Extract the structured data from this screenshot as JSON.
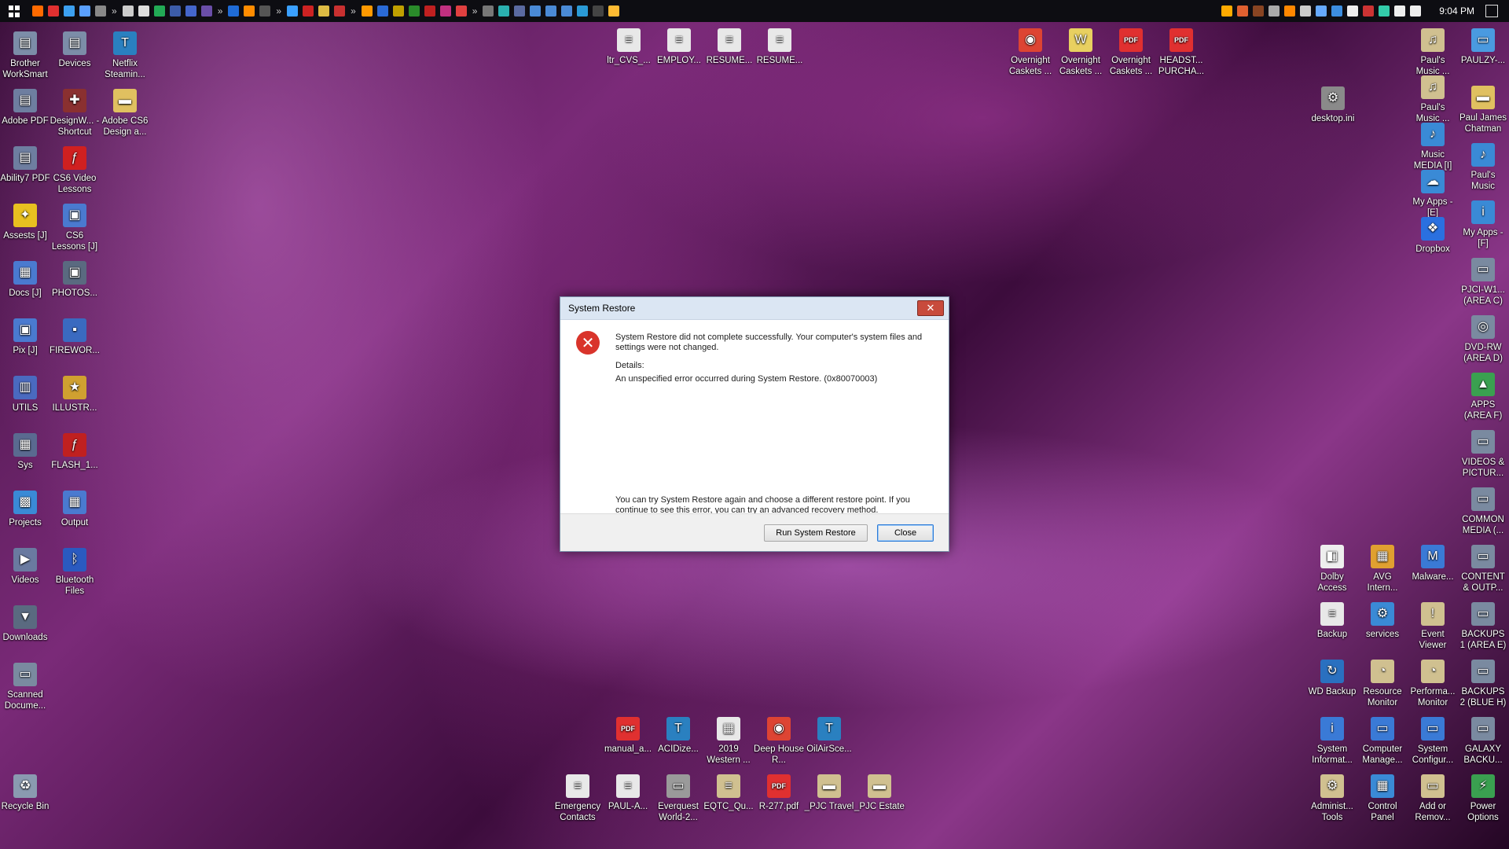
{
  "taskbar": {
    "clock": "9:04 PM",
    "more_glyph": "»",
    "icons_left": [
      "#ff6a00",
      "#e03030",
      "#3ca0f0",
      "#5aa0ff",
      "#888",
      "#ccc",
      "#ddd",
      "#22aa55",
      "#3c5ca8",
      "#4466cc",
      "#6a4ea8",
      "#1f6bd6",
      "#ff8c00",
      "#555",
      "#3aa0ff",
      "#cc2222",
      "#ddbb44",
      "#c83030",
      "#ff9900",
      "#2a6ad6",
      "#c0a000",
      "#2a8a2a",
      "#c02020",
      "#c03080",
      "#e04040",
      "#777",
      "#2ab0b0",
      "#5a6aa0",
      "#4a8ad6",
      "#4a8ad6",
      "#4a8ad6",
      "#2a9ad6",
      "#444",
      "#ffbb33"
    ],
    "icons_tray": [
      "#ffaa00",
      "#e06030",
      "#884422",
      "#aaa",
      "#ff8800",
      "#ccc",
      "#66aaff",
      "#3c8ee0",
      "#eee",
      "#cc3333",
      "#33ccaa",
      "#eee",
      "#eee"
    ]
  },
  "desktop": {
    "left_col1": [
      {
        "label": "Brother WorkSmart",
        "icon": "printer-icon",
        "color": "#7c8da8",
        "glyph": "▤"
      },
      {
        "label": "Adobe PDF",
        "icon": "printer-icon",
        "color": "#6e7ea0",
        "glyph": "▤"
      },
      {
        "label": "Ability7 PDF",
        "icon": "printer-icon",
        "color": "#6e7ea0",
        "glyph": "▤"
      },
      {
        "label": "Assests [J]",
        "icon": "lightbulb-icon",
        "color": "#e8c020",
        "glyph": "✦"
      },
      {
        "label": "Docs [J]",
        "icon": "documents-icon",
        "color": "#4a7ad0",
        "glyph": "▦"
      },
      {
        "label": "Pix [J]",
        "icon": "pictures-icon",
        "color": "#4a7ad0",
        "glyph": "▣"
      },
      {
        "label": "UTILS",
        "icon": "folder-icon",
        "color": "#4a6ac0",
        "glyph": "▥"
      },
      {
        "label": "Sys",
        "icon": "system-icon",
        "color": "#5a6a90",
        "glyph": "▦"
      },
      {
        "label": "Projects",
        "icon": "projects-icon",
        "color": "#3a8ad6",
        "glyph": "▩"
      },
      {
        "label": "Videos",
        "icon": "videos-icon",
        "color": "#6a7aa0",
        "glyph": "▶"
      },
      {
        "label": "Downloads",
        "icon": "downloads-icon",
        "color": "#5a6a80",
        "glyph": "▼"
      },
      {
        "label": "Scanned Docume...",
        "icon": "scanner-icon",
        "color": "#7a8aa0",
        "glyph": "▭"
      },
      {
        "label": "Recycle Bin",
        "icon": "recycle-bin-icon",
        "color": "#8a9ab0",
        "glyph": "♻"
      }
    ],
    "left_col2": [
      {
        "label": "Devices",
        "icon": "printer-icon",
        "color": "#7c8da8",
        "glyph": "▤"
      },
      {
        "label": "DesignW... - Shortcut",
        "icon": "designw-icon",
        "color": "#8a3030",
        "glyph": "✚"
      },
      {
        "label": "CS6 Video Lessons",
        "icon": "flash-icon",
        "color": "#d02020",
        "glyph": "ƒ"
      },
      {
        "label": "CS6 Lessons [J]",
        "icon": "lessons-icon",
        "color": "#4a7ad0",
        "glyph": "▣"
      },
      {
        "label": "PHOTOS...",
        "icon": "photos-icon",
        "color": "#5a6a80",
        "glyph": "▣"
      },
      {
        "label": "FIREWOR...",
        "icon": "fireworks-icon",
        "color": "#3a6ac0",
        "glyph": "▪"
      },
      {
        "label": "ILLUSTR...",
        "icon": "illustrator-icon",
        "color": "#d0a030",
        "glyph": "★"
      },
      {
        "label": "FLASH_1...",
        "icon": "flash-folder-icon",
        "color": "#c02020",
        "glyph": "ƒ"
      },
      {
        "label": "Output",
        "icon": "output-icon",
        "color": "#4a7ad0",
        "glyph": "▦"
      },
      {
        "label": "Bluetooth Files",
        "icon": "bluetooth-icon",
        "color": "#2a5ac0",
        "glyph": "ᛒ"
      }
    ],
    "left_col3": [
      {
        "label": "Netflix Steamin...",
        "icon": "netflix-icon",
        "color": "#2a80c0",
        "glyph": "T"
      },
      {
        "label": "Adobe CS6 Design a...",
        "icon": "folder-icon",
        "color": "#e0c060",
        "glyph": "▬"
      }
    ],
    "top_files": [
      {
        "label": "ltr_CVS_...",
        "icon": "document-icon",
        "color": "#e8e8e8",
        "glyph": "≡"
      },
      {
        "label": "EMPLOY...",
        "icon": "document-icon",
        "color": "#e8e8e8",
        "glyph": "≡"
      },
      {
        "label": "RESUME...",
        "icon": "document-icon",
        "color": "#e8e8e8",
        "glyph": "≡"
      },
      {
        "label": "RESUME...",
        "icon": "document-icon",
        "color": "#e8e8e8",
        "glyph": "≡"
      }
    ],
    "top_right_files": [
      {
        "label": "Overnight Caskets ...",
        "icon": "chrome-icon",
        "color": "#dd4433",
        "glyph": "◉"
      },
      {
        "label": "Overnight Caskets ...",
        "icon": "word-doc-icon",
        "color": "#e8d060",
        "glyph": "W"
      },
      {
        "label": "Overnight Caskets ...",
        "icon": "pdf-icon",
        "color": "#e03030",
        "glyph": "PDF"
      },
      {
        "label": "HEADST... PURCHA...",
        "icon": "pdf-icon",
        "color": "#e03030",
        "glyph": "PDF"
      }
    ],
    "desktop_ini": {
      "label": "desktop.ini",
      "icon": "settings-file-icon",
      "color": "#8a8a8a",
      "glyph": "⚙"
    },
    "right_col_a": [
      {
        "label": "Paul's Music ...",
        "icon": "music-folder-icon",
        "color": "#d0c090",
        "glyph": "♫"
      },
      {
        "label": "Paul's Music ...",
        "icon": "music-folder-icon",
        "color": "#d0c090",
        "glyph": "♫"
      },
      {
        "label": "Music MEDIA [I]",
        "icon": "music-media-icon",
        "color": "#3a8ad6",
        "glyph": "♪"
      },
      {
        "label": "My Apps - [E]",
        "icon": "cloud-icon",
        "color": "#3a8ad6",
        "glyph": "☁"
      },
      {
        "label": "Dropbox",
        "icon": "dropbox-icon",
        "color": "#2a70e0",
        "glyph": "❖"
      }
    ],
    "right_col_b": [
      {
        "label": "PAULZY-...",
        "icon": "computer-icon",
        "color": "#4a9ae0",
        "glyph": "▭"
      },
      {
        "label": "Paul James Chatman",
        "icon": "user-folder-icon",
        "color": "#e0c060",
        "glyph": "▬"
      },
      {
        "label": "Paul's Music",
        "icon": "music-icon",
        "color": "#3a8ad6",
        "glyph": "♪"
      },
      {
        "label": "My Apps - [F]",
        "icon": "info-icon",
        "color": "#3a8ad6",
        "glyph": "i"
      },
      {
        "label": "PJCI-W1... (AREA C)",
        "icon": "drive-icon",
        "color": "#7a8aa0",
        "glyph": "▭"
      },
      {
        "label": "DVD-RW (AREA D)",
        "icon": "dvd-icon",
        "color": "#7a8aa0",
        "glyph": "◎"
      },
      {
        "label": "APPS (AREA F)",
        "icon": "apps-drive-icon",
        "color": "#3aa050",
        "glyph": "▲"
      },
      {
        "label": "VIDEOS & PICTUR...",
        "icon": "drive-icon",
        "color": "#7a8aa0",
        "glyph": "▭"
      },
      {
        "label": "COMMON MEDIA (...",
        "icon": "drive-icon",
        "color": "#7a8aa0",
        "glyph": "▭"
      },
      {
        "label": "CONTENT & OUTP...",
        "icon": "drive-icon",
        "color": "#7a8aa0",
        "glyph": "▭"
      },
      {
        "label": "BACKUPS 1 (AREA E)",
        "icon": "drive-icon",
        "color": "#7a8aa0",
        "glyph": "▭"
      },
      {
        "label": "BACKUPS 2 (BLUE H)",
        "icon": "drive-icon",
        "color": "#7a8aa0",
        "glyph": "▭"
      },
      {
        "label": "GALAXY BACKU...",
        "icon": "drive-icon",
        "color": "#7a8aa0",
        "glyph": "▭"
      },
      {
        "label": "Power Options",
        "icon": "power-options-icon",
        "color": "#3aa050",
        "glyph": "⚡"
      }
    ],
    "right_grid": [
      [
        {
          "label": "Dolby Access",
          "icon": "dolby-icon",
          "color": "#eeeeee",
          "glyph": "◧"
        },
        {
          "label": "AVG Intern...",
          "icon": "avg-icon",
          "color": "#e0a030",
          "glyph": "▦"
        },
        {
          "label": "Malware...",
          "icon": "malwarebytes-icon",
          "color": "#3a7ad6",
          "glyph": "M"
        }
      ],
      [
        {
          "label": "Backup",
          "icon": "backup-icon",
          "color": "#e8e8e8",
          "glyph": "≡"
        },
        {
          "label": "services",
          "icon": "gear-icon",
          "color": "#3a8ad6",
          "glyph": "⚙"
        },
        {
          "label": "Event Viewer",
          "icon": "event-viewer-icon",
          "color": "#d0c090",
          "glyph": "!"
        }
      ],
      [
        {
          "label": "WD Backup",
          "icon": "wd-backup-icon",
          "color": "#2a70c0",
          "glyph": "↻"
        },
        {
          "label": "Resource Monitor",
          "icon": "resource-monitor-icon",
          "color": "#d0c090",
          "glyph": "◔"
        },
        {
          "label": "Performa... Monitor",
          "icon": "performance-monitor-icon",
          "color": "#d0c090",
          "glyph": "◔"
        }
      ],
      [
        {
          "label": "System Informat...",
          "icon": "system-info-icon",
          "color": "#3a7ad6",
          "glyph": "i"
        },
        {
          "label": "Computer Manage...",
          "icon": "computer-management-icon",
          "color": "#3a7ad6",
          "glyph": "▭"
        },
        {
          "label": "System Configur...",
          "icon": "system-config-icon",
          "color": "#3a7ad6",
          "glyph": "▭"
        }
      ],
      [
        {
          "label": "Administ... Tools",
          "icon": "admin-tools-icon",
          "color": "#d0c090",
          "glyph": "⚙"
        },
        {
          "label": "Control Panel",
          "icon": "control-panel-icon",
          "color": "#3a8ad6",
          "glyph": "▦"
        },
        {
          "label": "Add or Remov...",
          "icon": "add-remove-icon",
          "color": "#d0c090",
          "glyph": "▭"
        }
      ]
    ],
    "bottom_row1": [
      {
        "label": "manual_a...",
        "icon": "pdf-icon",
        "color": "#e03030",
        "glyph": "PDF"
      },
      {
        "label": "ACIDize...",
        "icon": "acidize-icon",
        "color": "#2a80c0",
        "glyph": "T"
      },
      {
        "label": "2019 Western ...",
        "icon": "spreadsheet-icon",
        "color": "#e8e8e8",
        "glyph": "▦"
      },
      {
        "label": "Deep House R...",
        "icon": "chrome-icon",
        "color": "#dd4433",
        "glyph": "◉"
      },
      {
        "label": "OilAirSce...",
        "icon": "oilair-icon",
        "color": "#2a80c0",
        "glyph": "T"
      }
    ],
    "bottom_row2": [
      {
        "label": "Emergency Contacts",
        "icon": "document-icon",
        "color": "#e8e8e8",
        "glyph": "≡"
      },
      {
        "label": "PAUL-A...",
        "icon": "document-icon",
        "color": "#e8e8e8",
        "glyph": "≡"
      },
      {
        "label": "Everquest World-2...",
        "icon": "game-icon",
        "color": "#9a9a9a",
        "glyph": "▭"
      },
      {
        "label": "EQTC_Qu...",
        "icon": "document-icon",
        "color": "#d0c090",
        "glyph": "≡"
      },
      {
        "label": "R-277.pdf",
        "icon": "pdf-icon",
        "color": "#e03030",
        "glyph": "PDF"
      },
      {
        "label": "_PJC Travel",
        "icon": "folder-icon",
        "color": "#d0c090",
        "glyph": "▬"
      },
      {
        "label": "_PJC Estate",
        "icon": "folder-icon",
        "color": "#d0c090",
        "glyph": "▬"
      }
    ]
  },
  "dialog": {
    "title": "System Restore",
    "close_glyph": "✕",
    "error_glyph": "✕",
    "message": "System Restore did not complete successfully. Your computer's system files and settings were not changed.",
    "details_label": "Details:",
    "details_text": "An unspecified error occurred during System Restore. (0x80070003)",
    "hint": "You can try System Restore again and choose a different restore point. If you continue to see this error, you can try an advanced recovery method.",
    "run_button": "Run System Restore",
    "close_button": "Close"
  }
}
